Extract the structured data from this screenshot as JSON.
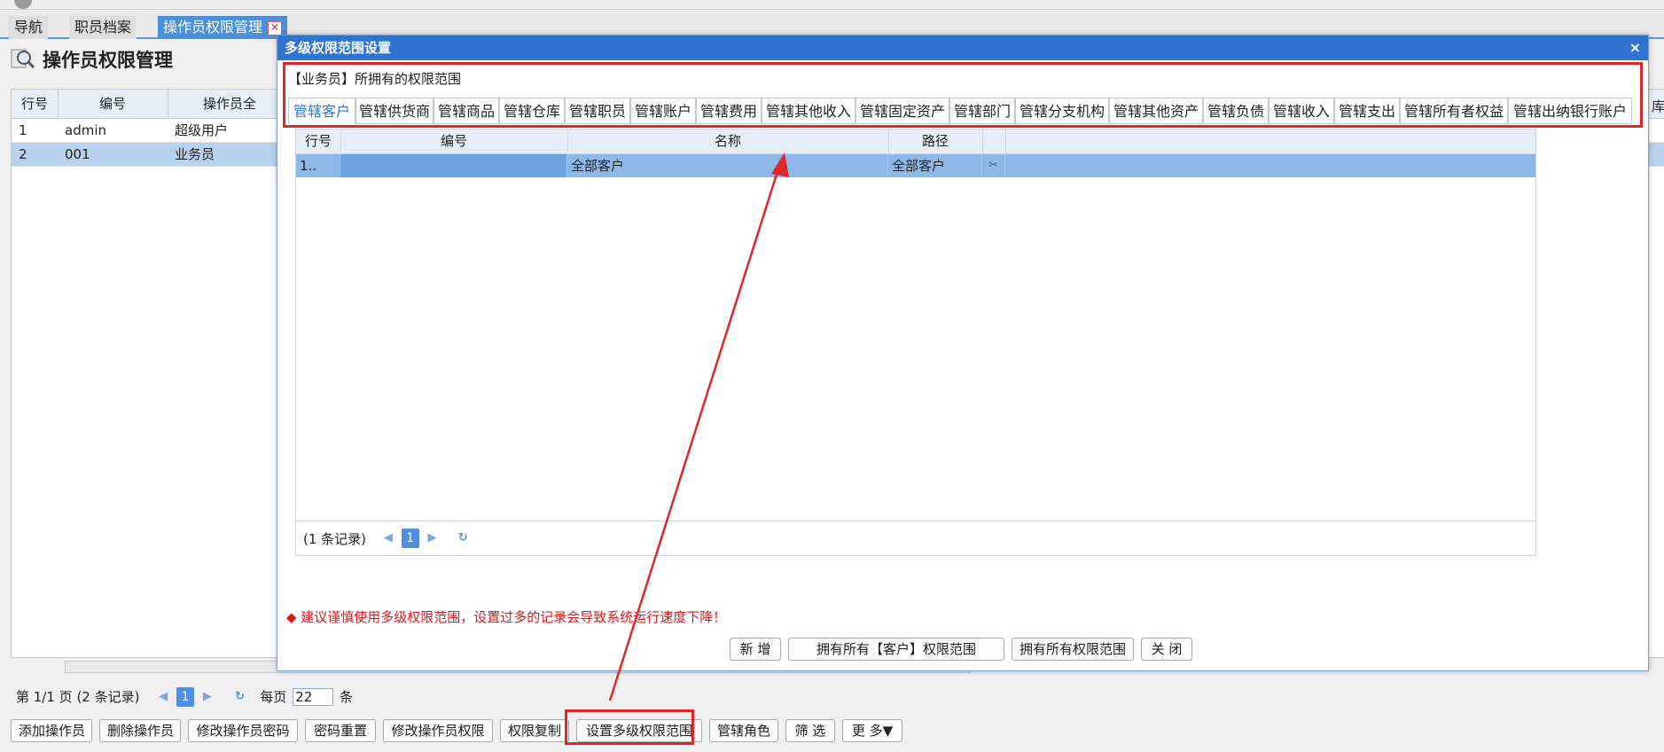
{
  "tabs": [
    {
      "label": "导航"
    },
    {
      "label": "职员档案"
    },
    {
      "label": "操作员权限管理"
    }
  ],
  "page": {
    "title": "操作员权限管理"
  },
  "operators_grid": {
    "columns": [
      "行号",
      "编号",
      "操作员全"
    ],
    "right_col_label": "库",
    "rows": [
      {
        "row": "1",
        "code": "admin",
        "name": "超级用户"
      },
      {
        "row": "2",
        "code": "001",
        "name": "业务员"
      }
    ]
  },
  "pager": {
    "page_text": "第 1/1 页 (2 条记录)",
    "page_num": "1",
    "per_page_label": "每页",
    "per_page_value": "22",
    "per_page_unit": "条",
    "prev_icon": "◀",
    "next_icon": "▶",
    "refresh_icon": "↻"
  },
  "toolbar": [
    {
      "label": "添加操作员"
    },
    {
      "label": "删除操作员"
    },
    {
      "label": "修改操作员密码"
    },
    {
      "label": "密码重置"
    },
    {
      "label": "修改操作员权限"
    },
    {
      "label": "权限复制"
    },
    {
      "label": "设置多级权限范围"
    },
    {
      "label": "管辖角色"
    },
    {
      "label": "筛 选"
    },
    {
      "label": "更 多▼"
    }
  ],
  "dialog": {
    "title": "多级权限范围设置",
    "close": "×",
    "scope_text": "【业务员】所拥有的权限范围",
    "tabs": [
      "管辖客户",
      "管辖供货商",
      "管辖商品",
      "管辖仓库",
      "管辖职员",
      "管辖账户",
      "管辖费用",
      "管辖其他收入",
      "管辖固定资产",
      "管辖部门",
      "管辖分支机构",
      "管辖其他资产",
      "管辖负债",
      "管辖收入",
      "管辖支出",
      "管辖所有者权益",
      "管辖出纳银行账户"
    ],
    "grid": {
      "columns": [
        "行号",
        "编号",
        "名称",
        "路径"
      ],
      "rows": [
        {
          "row": "1..",
          "code": "",
          "name": "全部客户",
          "path": "全部客户"
        }
      ]
    },
    "pager": {
      "count_text": "(1 条记录)",
      "page_num": "1"
    },
    "hint": "◆ 建议谨慎使用多级权限范围，设置过多的记录会导致系统运行速度下降！",
    "buttons": {
      "add": "新 增",
      "all_customer": "拥有所有【客户】权限范围",
      "all": "拥有所有权限范围",
      "close": "关 闭"
    }
  },
  "colors": {
    "accent": "#2f74d0",
    "highlight": "#e0262b",
    "selected_row": "#8db8e8"
  }
}
